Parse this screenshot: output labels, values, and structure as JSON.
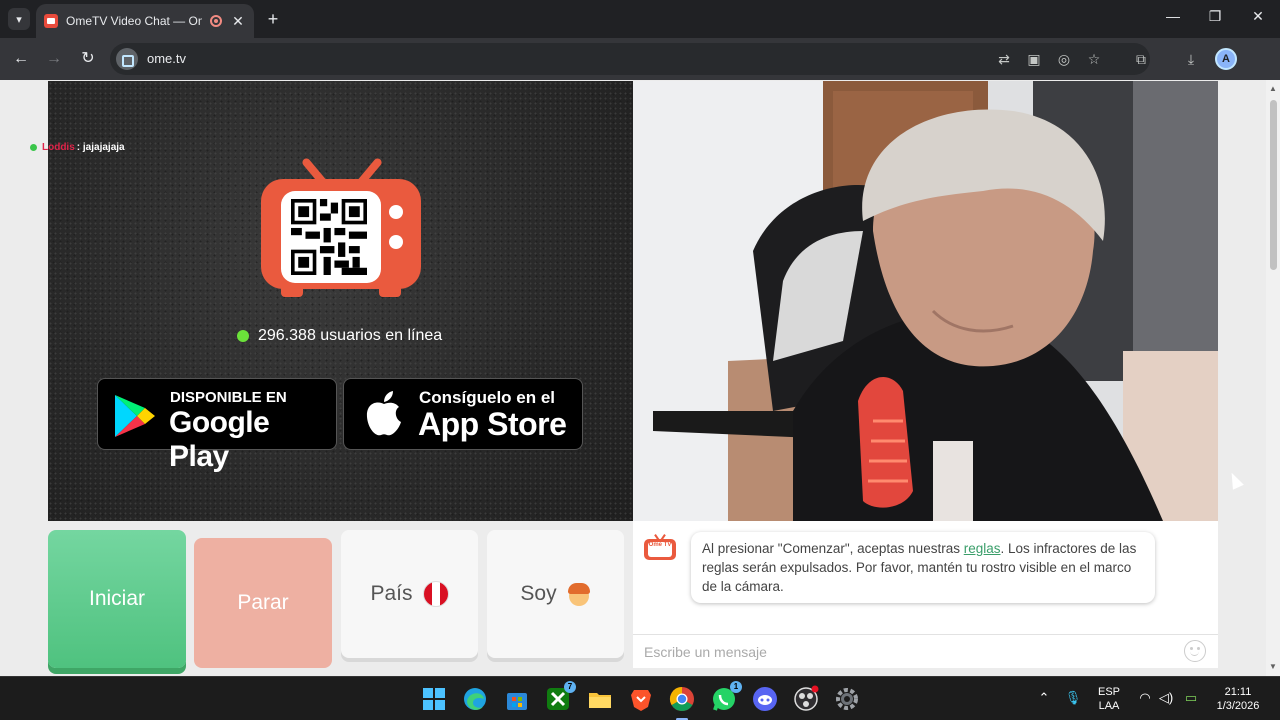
{
  "browser": {
    "tab_title": "OmeTV Video Chat — OmeTV",
    "tab_close": "✕",
    "new_tab": "+",
    "url": "ome.tv",
    "window_controls": {
      "minimize": "—",
      "maximize": "❐",
      "close": "✕"
    }
  },
  "left_panel": {
    "chat_overlay_user": "Loddis",
    "chat_overlay_message": ": jajajajaja",
    "online_text": "296.388 usuarios en línea",
    "google_play": {
      "small": "DISPONIBLE EN",
      "big": "Google Play"
    },
    "app_store": {
      "small": "Consíguelo en el",
      "big": "App Store"
    }
  },
  "controls": {
    "start_label": "Iniciar",
    "stop_label": "Parar",
    "country_label": "País",
    "gender_label": "Soy"
  },
  "chat": {
    "logo_text": "Ome TV",
    "rules_before": "Al presionar \"Comenzar\", aceptas nuestras ",
    "rules_link": "reglas",
    "rules_after": ". Los infractores de las reglas serán expulsados. Por favor, mantén tu rostro visible en el marco de la cámara.",
    "input_placeholder": "Escribe un mensaje"
  },
  "taskbar": {
    "lang_top": "ESP",
    "lang_bottom": "LAA",
    "time": "21:11",
    "date": "1/3/2026",
    "xbox_badge": "7",
    "whatsapp_badge": "1"
  },
  "colors": {
    "accent_green": "#4fc27f",
    "stop_salmon": "#eeb0a2",
    "ometv_red": "#ea5a3e",
    "online_dot": "#6be23a"
  }
}
